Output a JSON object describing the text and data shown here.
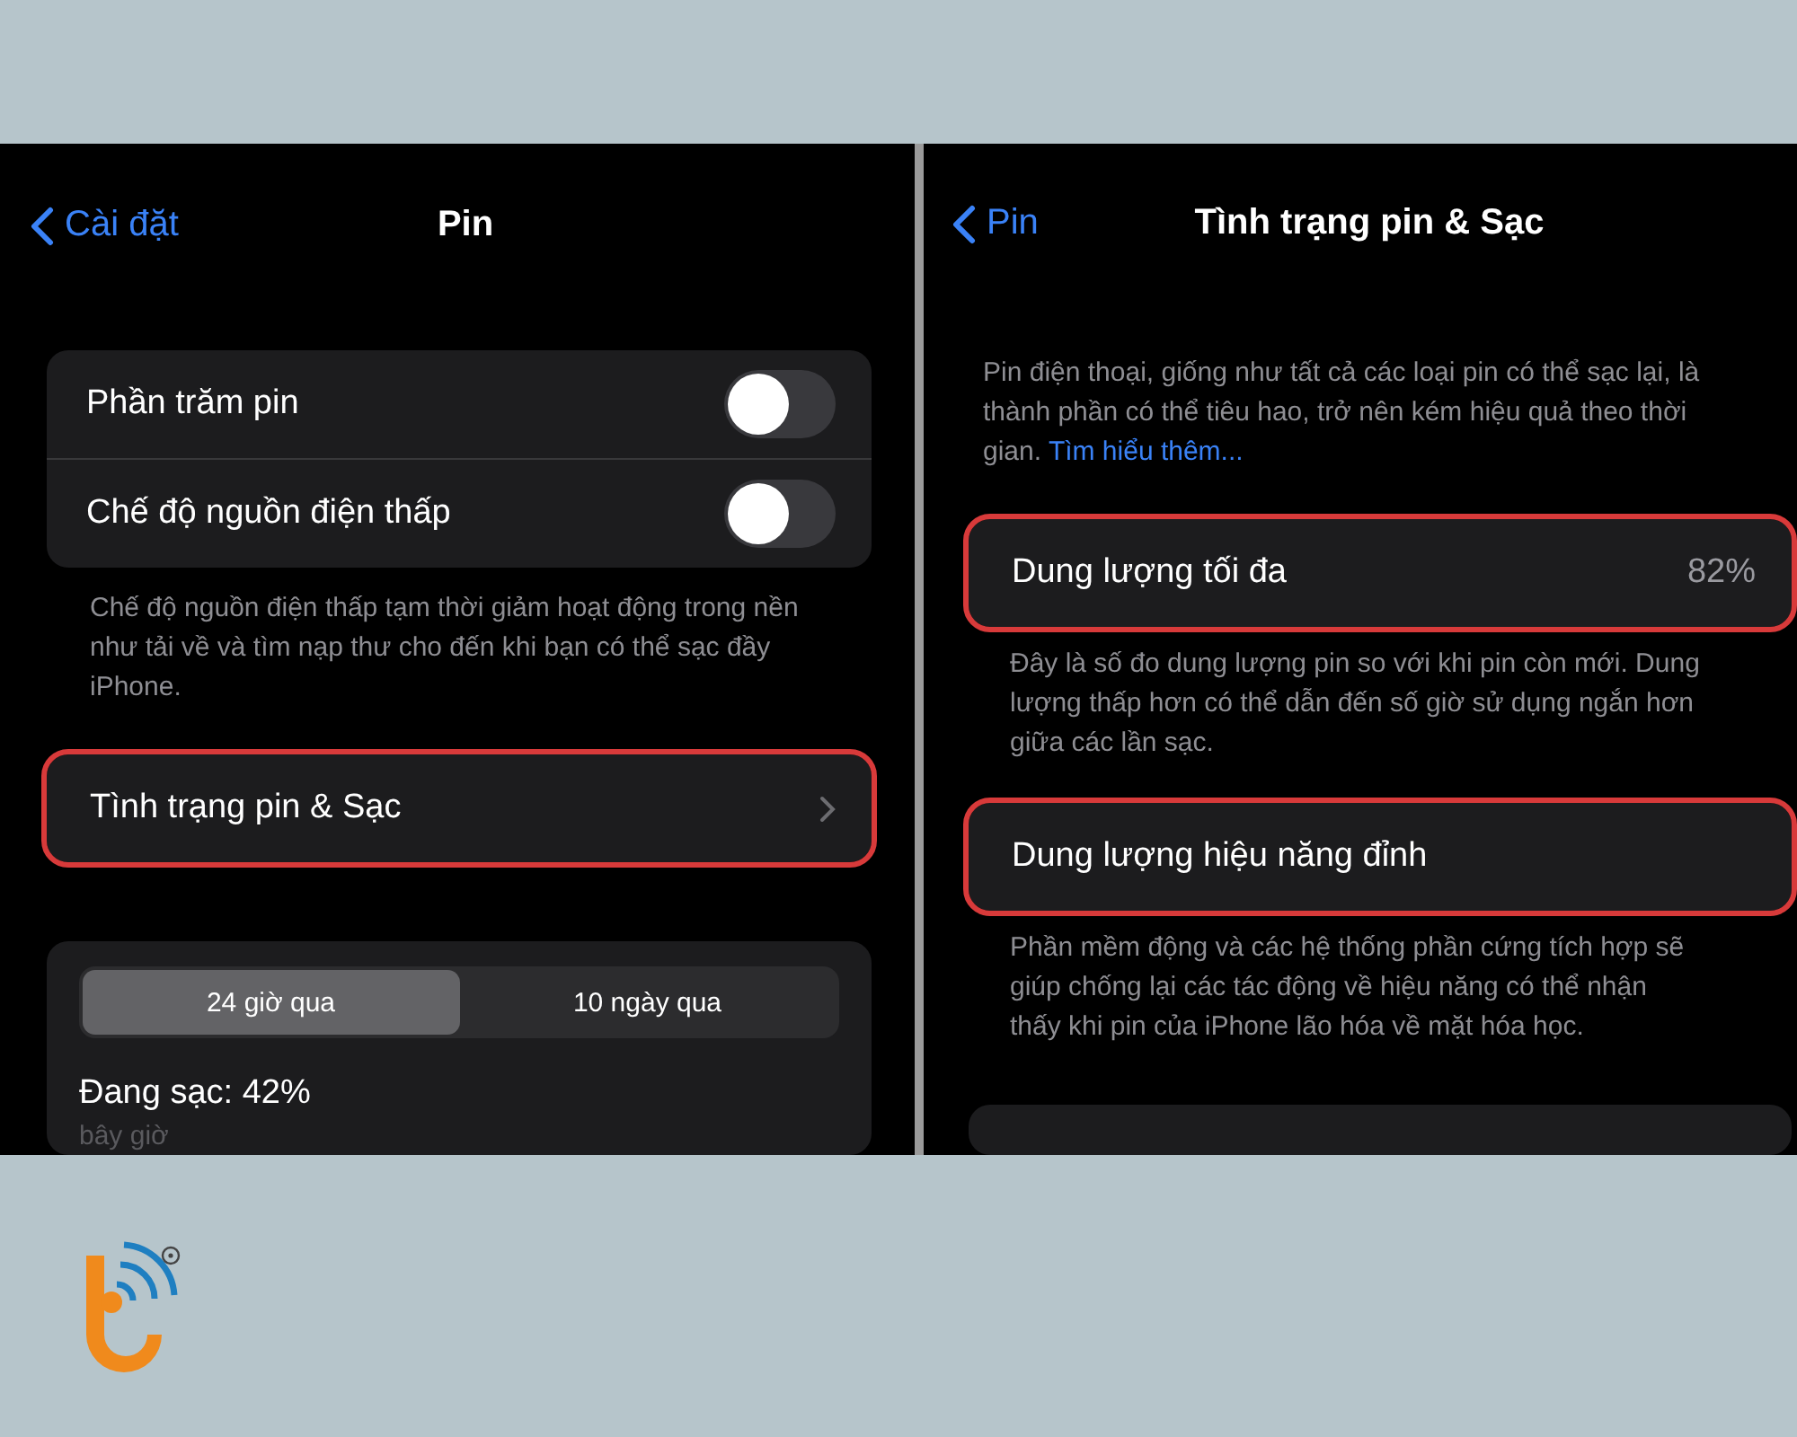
{
  "panels": [
    {
      "back": "Cài đặt",
      "title": "Pin",
      "items": [
        {
          "kind": "group",
          "rows": [
            {
              "label": "Phần trăm pin",
              "on": false
            },
            {
              "label": "Chế độ nguồn điện thấp",
              "on": false
            }
          ]
        },
        {
          "kind": "note",
          "text": "Chế độ nguồn điện thấp tạm thời giảm hoạt động trong nền như tải về và tìm nạp thư cho đến khi bạn có thể sạc đầy iPhone."
        },
        {
          "kind": "row",
          "label": "Tình trạng pin & Sạc",
          "chevron": true,
          "highlighted": true
        },
        {
          "kind": "usage",
          "segments": [
            {
              "label": "24 giờ qua",
              "selected": true
            },
            {
              "label": "10 ngày qua",
              "selected": false
            }
          ],
          "status": "Đang sạc: 42%",
          "time": "bây giờ"
        }
      ]
    },
    {
      "back": "Pin",
      "title": "Tình trạng pin & Sạc",
      "items": [
        {
          "kind": "note",
          "text": "Pin điện thoại, giống như tất cả các loại pin có thể sạc lại, là thành phần có thể tiêu hao, trở nên kém hiệu quả theo thời gian.",
          "link": "Tìm hiểu thêm..."
        },
        {
          "kind": "row",
          "label": "Dung lượng tối đa",
          "value": "82%",
          "chevron": false,
          "highlighted": true
        },
        {
          "kind": "note",
          "text": "Đây là số đo dung lượng pin so với khi pin còn mới. Dung lượng thấp hơn có thể dẫn đến số giờ sử dụng ngắn hơn giữa các lần sạc."
        },
        {
          "kind": "row",
          "label": "Dung lượng hiệu năng đỉnh",
          "chevron": false,
          "highlighted": true
        },
        {
          "kind": "note",
          "text": "Phần mềm động và các hệ thống phần cứng tích hợp sẽ giúp chống lại các tác động về hiệu năng có thể nhận thấy khi pin của iPhone lão hóa về mặt hóa học."
        },
        {
          "kind": "card"
        }
      ]
    }
  ]
}
